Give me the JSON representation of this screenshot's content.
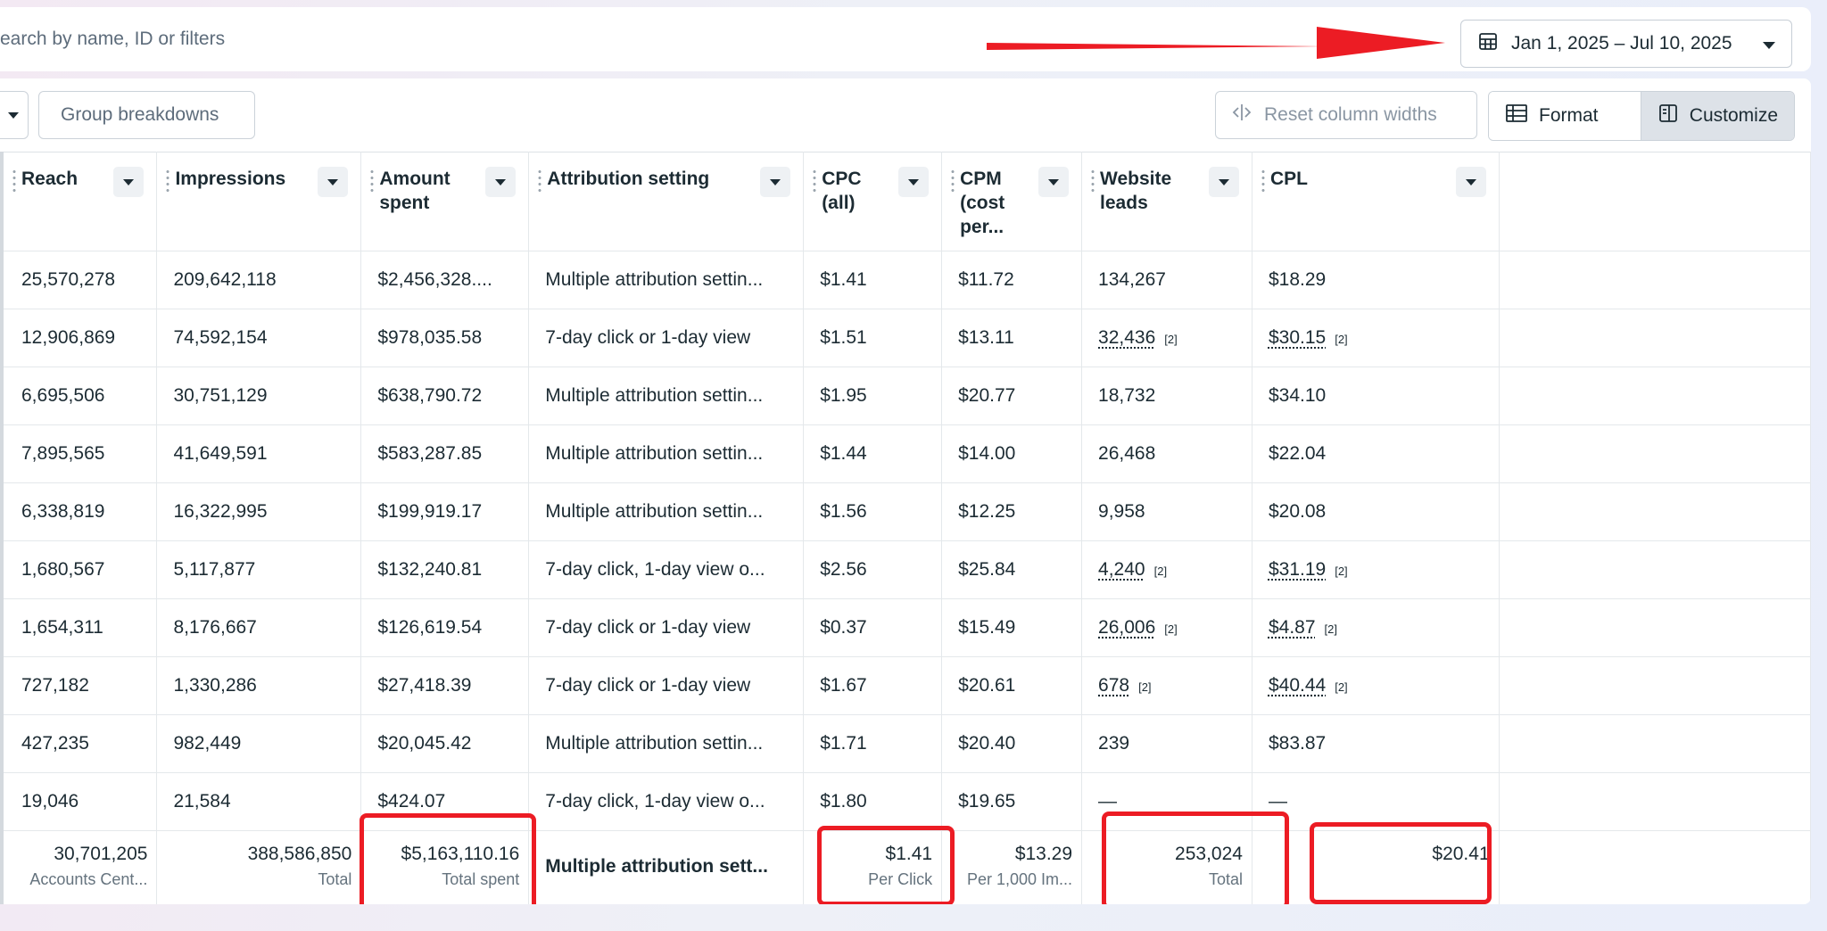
{
  "search": {
    "text": "earch by name, ID or filters"
  },
  "date_range": {
    "label": "Jan 1, 2025 – Jul 10, 2025"
  },
  "toolbar": {
    "group_breakdowns": "Group breakdowns",
    "reset_column_widths": "Reset column widths",
    "format": "Format",
    "customize": "Customize"
  },
  "columns": [
    {
      "label": "Reach"
    },
    {
      "label": "Impressions"
    },
    {
      "label": "Amount spent"
    },
    {
      "label": "Attribution setting"
    },
    {
      "label": "CPC (all)"
    },
    {
      "label": "CPM (cost per..."
    },
    {
      "label": "Website leads"
    },
    {
      "label": "CPL"
    }
  ],
  "rows": [
    {
      "reach": "25,570,278",
      "impressions": "209,642,118",
      "amount_spent": "$2,456,328....",
      "attribution": "Multiple attribution settin...",
      "cpc": "$1.41",
      "cpm": "$11.72",
      "leads": "134,267",
      "leads_note": "",
      "cpl": "$18.29",
      "cpl_note": ""
    },
    {
      "reach": "12,906,869",
      "impressions": "74,592,154",
      "amount_spent": "$978,035.58",
      "attribution": "7-day click or 1-day view",
      "cpc": "$1.51",
      "cpm": "$13.11",
      "leads": "32,436",
      "leads_note": "[2]",
      "cpl": "$30.15",
      "cpl_note": "[2]"
    },
    {
      "reach": "6,695,506",
      "impressions": "30,751,129",
      "amount_spent": "$638,790.72",
      "attribution": "Multiple attribution settin...",
      "cpc": "$1.95",
      "cpm": "$20.77",
      "leads": "18,732",
      "leads_note": "",
      "cpl": "$34.10",
      "cpl_note": ""
    },
    {
      "reach": "7,895,565",
      "impressions": "41,649,591",
      "amount_spent": "$583,287.85",
      "attribution": "Multiple attribution settin...",
      "cpc": "$1.44",
      "cpm": "$14.00",
      "leads": "26,468",
      "leads_note": "",
      "cpl": "$22.04",
      "cpl_note": ""
    },
    {
      "reach": "6,338,819",
      "impressions": "16,322,995",
      "amount_spent": "$199,919.17",
      "attribution": "Multiple attribution settin...",
      "cpc": "$1.56",
      "cpm": "$12.25",
      "leads": "9,958",
      "leads_note": "",
      "cpl": "$20.08",
      "cpl_note": ""
    },
    {
      "reach": "1,680,567",
      "impressions": "5,117,877",
      "amount_spent": "$132,240.81",
      "attribution": "7-day click, 1-day view o...",
      "cpc": "$2.56",
      "cpm": "$25.84",
      "leads": "4,240",
      "leads_note": "[2]",
      "cpl": "$31.19",
      "cpl_note": "[2]"
    },
    {
      "reach": "1,654,311",
      "impressions": "8,176,667",
      "amount_spent": "$126,619.54",
      "attribution": "7-day click or 1-day view",
      "cpc": "$0.37",
      "cpm": "$15.49",
      "leads": "26,006",
      "leads_note": "[2]",
      "cpl": "$4.87",
      "cpl_note": "[2]"
    },
    {
      "reach": "727,182",
      "impressions": "1,330,286",
      "amount_spent": "$27,418.39",
      "attribution": "7-day click or 1-day view",
      "cpc": "$1.67",
      "cpm": "$20.61",
      "leads": "678",
      "leads_note": "[2]",
      "cpl": "$40.44",
      "cpl_note": "[2]"
    },
    {
      "reach": "427,235",
      "impressions": "982,449",
      "amount_spent": "$20,045.42",
      "attribution": "Multiple attribution settin...",
      "cpc": "$1.71",
      "cpm": "$20.40",
      "leads": "239",
      "leads_note": "",
      "cpl": "$83.87",
      "cpl_note": ""
    },
    {
      "reach": "19,046",
      "impressions": "21,584",
      "amount_spent": "$424.07",
      "attribution": "7-day click, 1-day view o...",
      "cpc": "$1.80",
      "cpm": "$19.65",
      "leads": "—",
      "leads_note": "",
      "cpl": "—",
      "cpl_note": ""
    }
  ],
  "totals": {
    "reach": {
      "value": "30,701,205",
      "label": "Accounts Cent..."
    },
    "impressions": {
      "value": "388,586,850",
      "label": "Total"
    },
    "amount_spent": {
      "value": "$5,163,110.16",
      "label": "Total spent"
    },
    "attribution": {
      "value": "Multiple attribution sett..."
    },
    "cpc": {
      "value": "$1.41",
      "label": "Per Click"
    },
    "cpm": {
      "value": "$13.29",
      "label": "Per 1,000 Im..."
    },
    "leads": {
      "value": "253,024",
      "label": "Total"
    },
    "cpl": {
      "value": "$20.41",
      "label": ""
    }
  },
  "colors": {
    "annotation_red": "#ec1c24",
    "text": "#1c2b33",
    "muted": "#65737e"
  },
  "icons": [
    "calendar-icon",
    "caret-down-icon",
    "reset-columns-icon",
    "format-icon",
    "customize-icon"
  ]
}
